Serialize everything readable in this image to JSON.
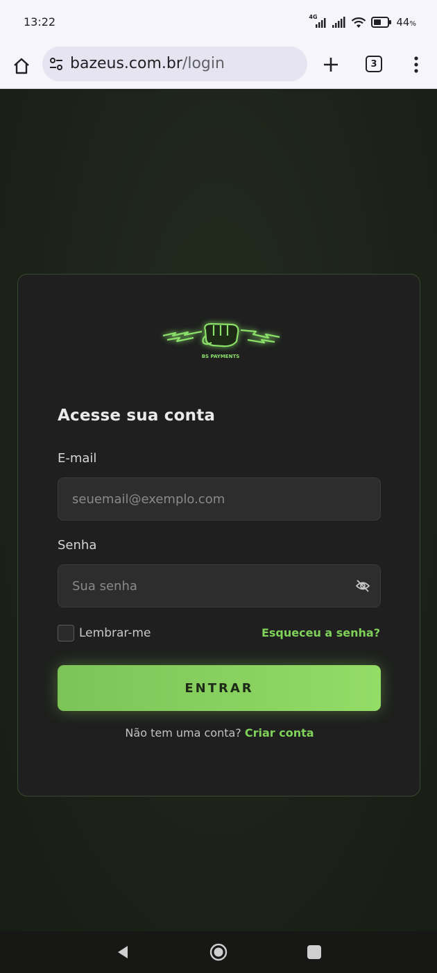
{
  "status_bar": {
    "time": "13:22",
    "network_type": "4G",
    "battery": "44",
    "battery_unit": "%"
  },
  "browser": {
    "url_domain": "bazeus.com.br",
    "url_path": "/login",
    "tab_count": "3",
    "icons": [
      "home-icon",
      "site-info-icon",
      "plus-icon",
      "tabs-icon",
      "more-vert-icon"
    ]
  },
  "login": {
    "logo_text": "BS PAYMENTS",
    "heading": "Acesse sua conta",
    "email_label": "E-mail",
    "email_placeholder": "seuemail@exemplo.com",
    "password_label": "Senha",
    "password_placeholder": "Sua senha",
    "remember_label": "Lembrar-me",
    "forgot_link": "Esqueceu a senha?",
    "submit_label": "ENTRAR",
    "signup_prompt": "Não tem uma conta?",
    "signup_link": "Criar conta"
  },
  "colors": {
    "accent": "#7fd15a",
    "button_start": "#7cc458",
    "button_end": "#93dc66",
    "card_bg": "#1e1f1e",
    "page_bg": "#1b2017"
  }
}
